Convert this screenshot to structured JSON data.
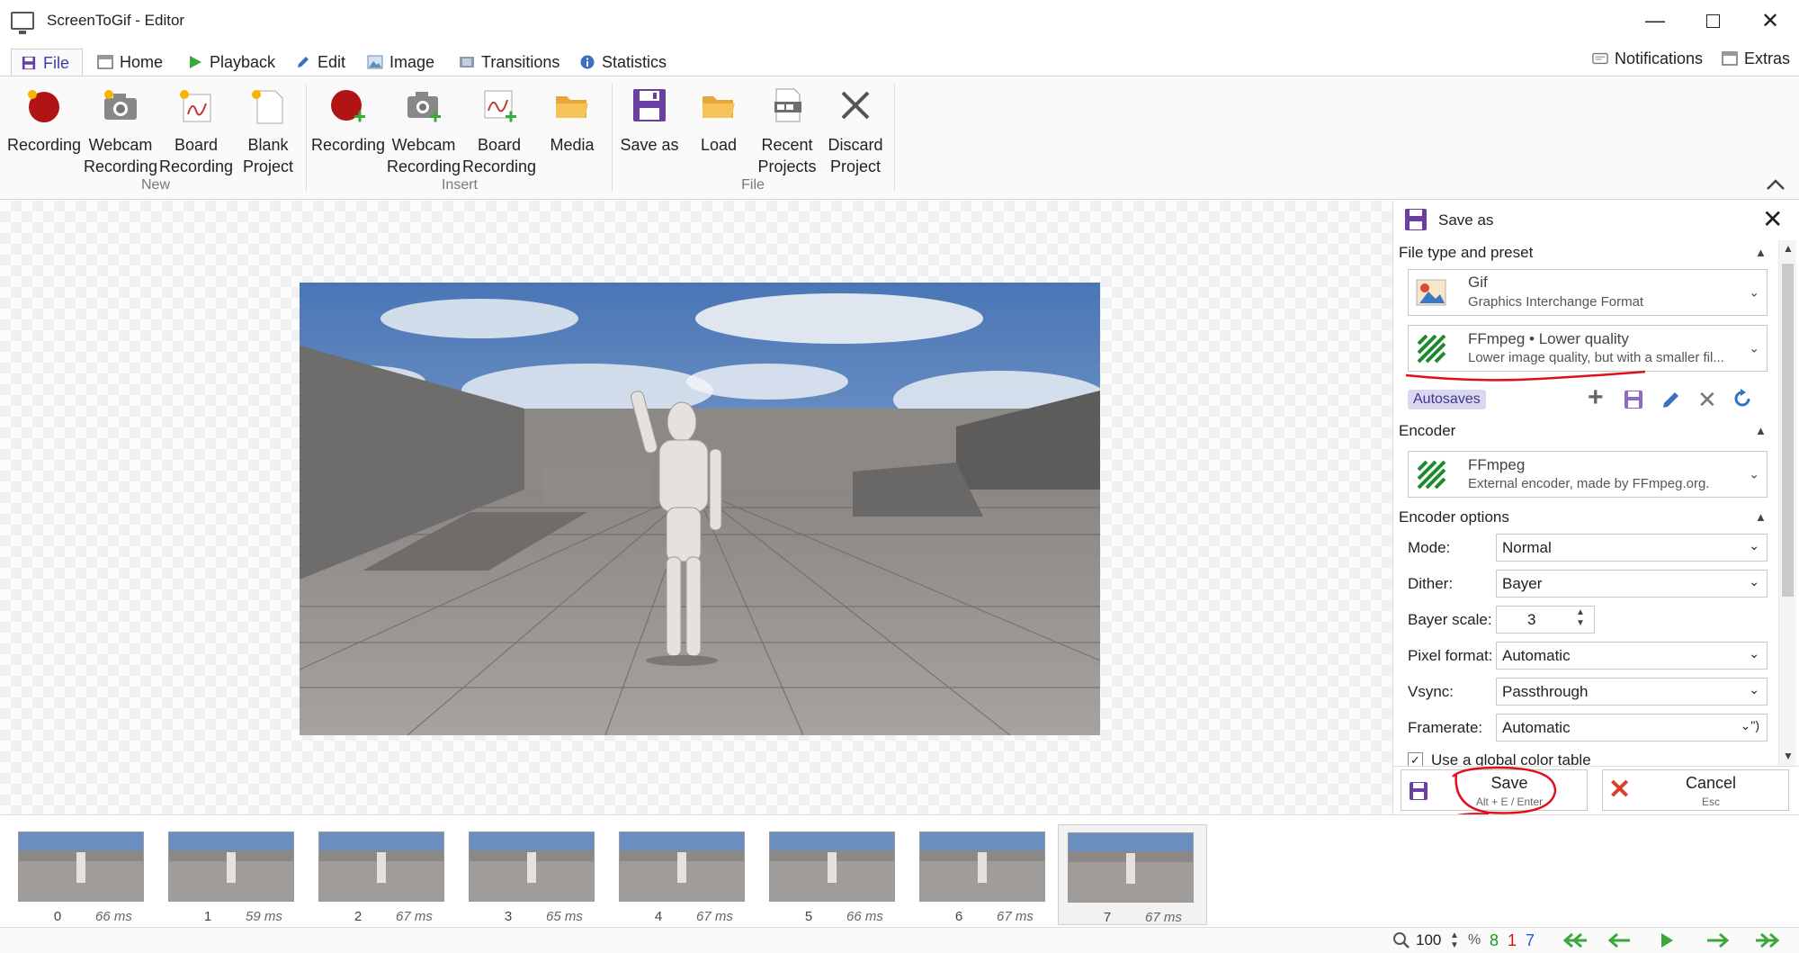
{
  "window": {
    "title": "ScreenToGif - Editor"
  },
  "tabs": [
    {
      "label": "File",
      "icon": "save-icon"
    },
    {
      "label": "Home",
      "icon": "home-icon"
    },
    {
      "label": "Playback",
      "icon": "play-icon"
    },
    {
      "label": "Edit",
      "icon": "pencil-icon"
    },
    {
      "label": "Image",
      "icon": "image-icon"
    },
    {
      "label": "Transitions",
      "icon": "transitions-icon"
    },
    {
      "label": "Statistics",
      "icon": "info-icon"
    }
  ],
  "header_right": {
    "notifications": "Notifications",
    "extras": "Extras"
  },
  "ribbon": {
    "groups": [
      "New",
      "Insert",
      "File"
    ],
    "new": [
      {
        "line1": "Recording",
        "line2": ""
      },
      {
        "line1": "Webcam",
        "line2": "Recording"
      },
      {
        "line1": "Board",
        "line2": "Recording"
      },
      {
        "line1": "Blank",
        "line2": "Project"
      }
    ],
    "insert": [
      {
        "line1": "Recording",
        "line2": ""
      },
      {
        "line1": "Webcam",
        "line2": "Recording"
      },
      {
        "line1": "Board",
        "line2": "Recording"
      },
      {
        "line1": "Media",
        "line2": ""
      }
    ],
    "file": [
      {
        "line1": "Save as",
        "line2": ""
      },
      {
        "line1": "Load",
        "line2": ""
      },
      {
        "line1": "Recent",
        "line2": "Projects"
      },
      {
        "line1": "Discard",
        "line2": "Project"
      }
    ]
  },
  "panel": {
    "title": "Save as",
    "file_type_section": "File type and preset",
    "file_type": {
      "name": "Gif",
      "desc": "Graphics Interchange Format"
    },
    "preset": {
      "name": "FFmpeg • Lower quality",
      "desc": "Lower image quality, but with a smaller fil..."
    },
    "autosaves": "Autosaves",
    "encoder_section": "Encoder",
    "encoder": {
      "name": "FFmpeg",
      "desc": "External encoder, made by FFmpeg.org."
    },
    "options_section": "Encoder options",
    "options": [
      {
        "label": "Mode:",
        "value": "Normal"
      },
      {
        "label": "Dither:",
        "value": "Bayer"
      },
      {
        "label": "Bayer scale:",
        "value": "3"
      },
      {
        "label": "Pixel format:",
        "value": "Automatic"
      },
      {
        "label": "Vsync:",
        "value": "Passthrough"
      },
      {
        "label": "Framerate:",
        "value": "Automatic"
      }
    ],
    "global_color_table": "Use a global color table",
    "save": {
      "label": "Save",
      "shortcut": "Alt + E / Enter"
    },
    "cancel": {
      "label": "Cancel",
      "shortcut": "Esc"
    }
  },
  "frames": [
    {
      "index": "0",
      "delay": "66 ms"
    },
    {
      "index": "1",
      "delay": "59 ms"
    },
    {
      "index": "2",
      "delay": "67 ms"
    },
    {
      "index": "3",
      "delay": "65 ms"
    },
    {
      "index": "4",
      "delay": "67 ms"
    },
    {
      "index": "5",
      "delay": "66 ms"
    },
    {
      "index": "6",
      "delay": "67 ms"
    },
    {
      "index": "7",
      "delay": "67 ms"
    }
  ],
  "status": {
    "zoom": "100",
    "percent": "%",
    "count_total": "8",
    "count_selected": "1",
    "count_current": "7"
  },
  "colors": {
    "accent": "#6b3fa0",
    "tab_active_text": "#3c3cab",
    "annotation_red": "#e0101a",
    "nav_green": "#3aa83a",
    "count_green": "#1a9a1a",
    "count_red": "#d11",
    "count_blue": "#1f5fbf"
  }
}
